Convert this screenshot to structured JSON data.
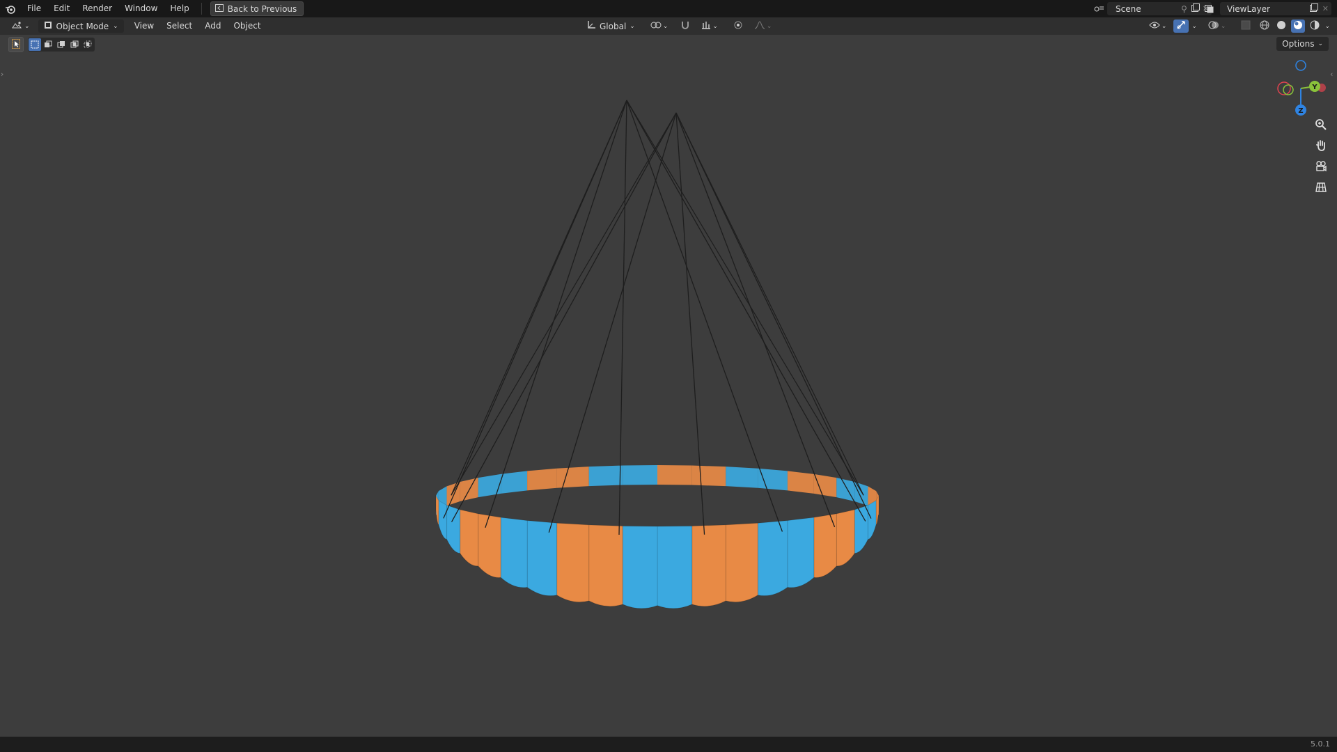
{
  "topbar": {
    "menus": [
      "File",
      "Edit",
      "Render",
      "Window",
      "Help"
    ],
    "back_button": "Back to Previous",
    "scene_label": "Scene",
    "viewlayer_label": "ViewLayer"
  },
  "header": {
    "mode": "Object Mode",
    "menus": [
      "View",
      "Select",
      "Add",
      "Object"
    ],
    "transform_orientation": "Global"
  },
  "toolbar": {
    "options_label": "Options"
  },
  "gizmo": {
    "y_label": "Y",
    "z_label": "Z",
    "colors": {
      "x": "#e0434f",
      "y": "#8ac33b",
      "z": "#2f84e3"
    }
  },
  "viewport": {
    "background": "#3d3d3d",
    "canopy_colors": {
      "orange": "#e88a45",
      "blue": "#3ba9e0"
    },
    "line_color": "#1e1e1e"
  },
  "status": {
    "version": "5.0.1"
  }
}
